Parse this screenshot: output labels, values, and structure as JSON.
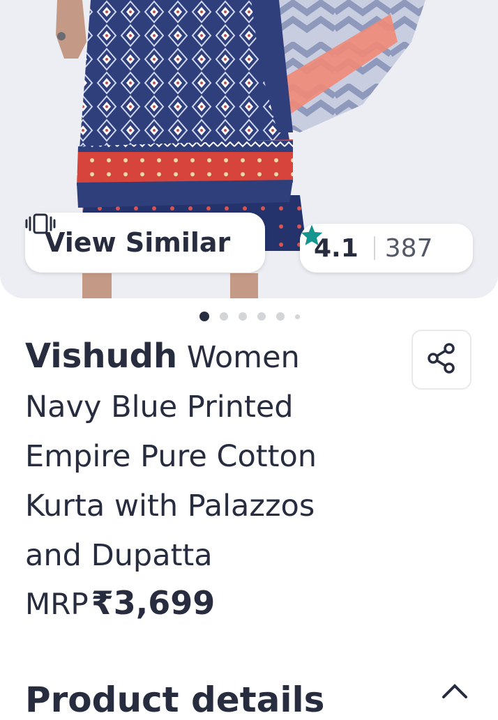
{
  "product_image": {
    "alt": "Vishudh Women Navy Blue Printed Empire Pure Cotton Kurta with Palazzos and Dupatta",
    "colors": {
      "navy": "#2e3f7c",
      "border_red": "#d6443b",
      "dupatta_pink": "#f08a78",
      "dupatta_grey": "#9ca6c3",
      "background": "#eceef3"
    }
  },
  "view_similar": {
    "label": "View Similar",
    "icon": "view-similar-icon"
  },
  "rating": {
    "value": "4.1",
    "count": "387",
    "star_color": "#14958f",
    "icon": "star-icon"
  },
  "carousel": {
    "total_dots": 6,
    "active_index": 0
  },
  "product": {
    "brand": "Vishudh",
    "name": "Women Navy Blue Printed Empire Pure Cotton Kurta with Palazzos and Dupatta"
  },
  "price": {
    "label": "MRP",
    "value": "₹3,699"
  },
  "share": {
    "icon": "share-icon"
  },
  "product_details": {
    "title": "Product details",
    "icon": "chevron-up-icon"
  }
}
